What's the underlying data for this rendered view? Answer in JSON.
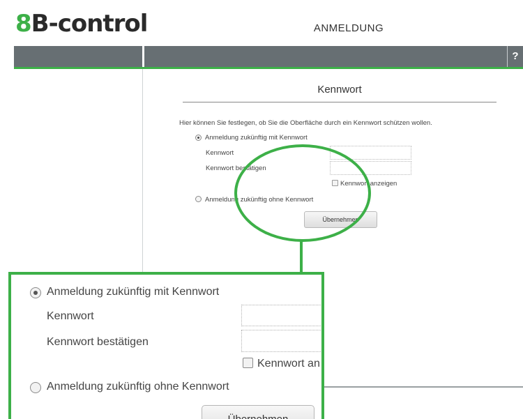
{
  "header": {
    "logo_prefix": "8",
    "logo_rest": "B-control",
    "title": "ANMELDUNG",
    "help_label": "?"
  },
  "form": {
    "title": "Kennwort",
    "description": "Hier können Sie festlegen, ob Sie die Oberfläche durch ein Kennwort schützen wollen.",
    "option_with_password": "Anmeldung zukünftig mit Kennwort",
    "option_with_password_selected": true,
    "password_label": "Kennwort",
    "password_value": "",
    "confirm_label": "Kennwort bestätigen",
    "confirm_value": "",
    "show_password_label": "Kennwort anzeigen",
    "show_password_checked": false,
    "option_without_password": "Anmeldung zukünftig ohne Kennwort",
    "submit_label": "Übernehmen"
  },
  "zoom": {
    "option_with_password": "Anmeldung zukünftig mit Kennwort",
    "password_label": "Kennwort",
    "confirm_label": "Kennwort bestätigen",
    "show_password_label": "Kennwort an",
    "option_without_password": "Anmeldung zukünftig ohne Kennwort",
    "submit_label": "Übernehmen"
  },
  "colors": {
    "accent_green": "#3db048",
    "toolbar_gray": "#676f73"
  }
}
